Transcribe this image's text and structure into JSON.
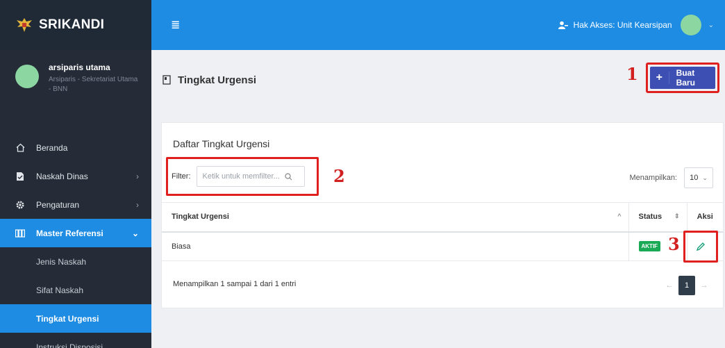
{
  "brand": {
    "name": "SRIKANDI"
  },
  "user": {
    "name": "arsiparis utama",
    "role": "Arsiparis - Sekretariat Utama - BNN"
  },
  "sidebar": {
    "items": [
      {
        "label": "Beranda",
        "icon": "home-icon"
      },
      {
        "label": "Naskah Dinas",
        "icon": "document-icon",
        "chevron": "›"
      },
      {
        "label": "Pengaturan",
        "icon": "gear-icon",
        "chevron": "›"
      },
      {
        "label": "Master Referensi",
        "icon": "archive-icon",
        "chevron": "⌄"
      }
    ],
    "subitems": [
      {
        "label": "Jenis Naskah"
      },
      {
        "label": "Sifat Naskah"
      },
      {
        "label": "Tingkat Urgensi"
      },
      {
        "label": "Instruksi Disposisi"
      }
    ]
  },
  "topbar": {
    "access_label": "Hak Akses: Unit Kearsipan"
  },
  "page": {
    "title": "Tingkat Urgensi",
    "new_button": "Buat Baru"
  },
  "annotations": {
    "a1": "1",
    "a2": "2",
    "a3": "3"
  },
  "card": {
    "title": "Daftar Tingkat Urgensi",
    "filter_label": "Filter:",
    "filter_placeholder": "Ketik untuk memfilter...",
    "show_label": "Menampilkan:",
    "show_value": "10"
  },
  "table": {
    "headers": {
      "name": "Tingkat Urgensi",
      "status": "Status",
      "aksi": "Aksi"
    },
    "rows": [
      {
        "name": "Biasa",
        "status": "AKTIF"
      }
    ]
  },
  "footer": {
    "info": "Menampilkan 1 sampai 1 dari 1 entri",
    "prev": "←",
    "page": "1",
    "next": "→"
  },
  "colors": {
    "topbar": "#1e8ce3",
    "sidebar": "#252c38",
    "primary_button": "#3d4fb3",
    "badge": "#1aaa55",
    "annotation": "#e0201f"
  }
}
